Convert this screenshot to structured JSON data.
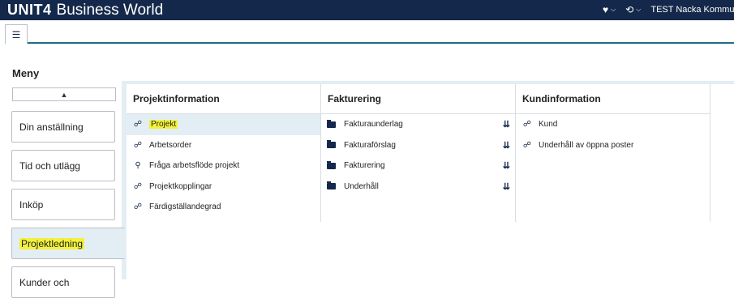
{
  "header": {
    "brand_logo": "UNIT4",
    "brand_app": "Business World",
    "favorites_icon": "heart-icon",
    "history_icon": "history-icon",
    "user_label": "TEST Nacka Kommun"
  },
  "tabs": {
    "menu_icon": "list-icon"
  },
  "menu": {
    "title": "Meny",
    "scroll_up_icon": "triangle-up-icon",
    "categories": [
      {
        "label": "Din anställning",
        "active": false
      },
      {
        "label": "Tid och utlägg",
        "active": false
      },
      {
        "label": "Inköp",
        "active": false
      },
      {
        "label": "Projektledning",
        "active": true
      },
      {
        "label": "Kunder och",
        "active": false
      }
    ]
  },
  "columns": [
    {
      "heading": "Projektinformation",
      "items": [
        {
          "label": "Projekt",
          "icon": "task-icon",
          "selected": true
        },
        {
          "label": "Arbetsorder",
          "icon": "task-icon"
        },
        {
          "label": "Fråga arbetsflöde projekt",
          "icon": "search-icon"
        },
        {
          "label": "Projektkopplingar",
          "icon": "task-icon"
        },
        {
          "label": "Färdigställandegrad",
          "icon": "task-icon"
        }
      ]
    },
    {
      "heading": "Fakturering",
      "items": [
        {
          "label": "Fakturaunderlag",
          "icon": "folder-icon"
        },
        {
          "label": "Fakturaförslag",
          "icon": "folder-icon"
        },
        {
          "label": "Fakturering",
          "icon": "folder-icon"
        },
        {
          "label": "Underhåll",
          "icon": "folder-icon"
        }
      ]
    },
    {
      "heading": "Kundinformation",
      "items": [
        {
          "label": "Kund",
          "icon": "task-icon"
        },
        {
          "label": "Underhåll av öppna poster",
          "icon": "task-icon"
        }
      ]
    }
  ]
}
